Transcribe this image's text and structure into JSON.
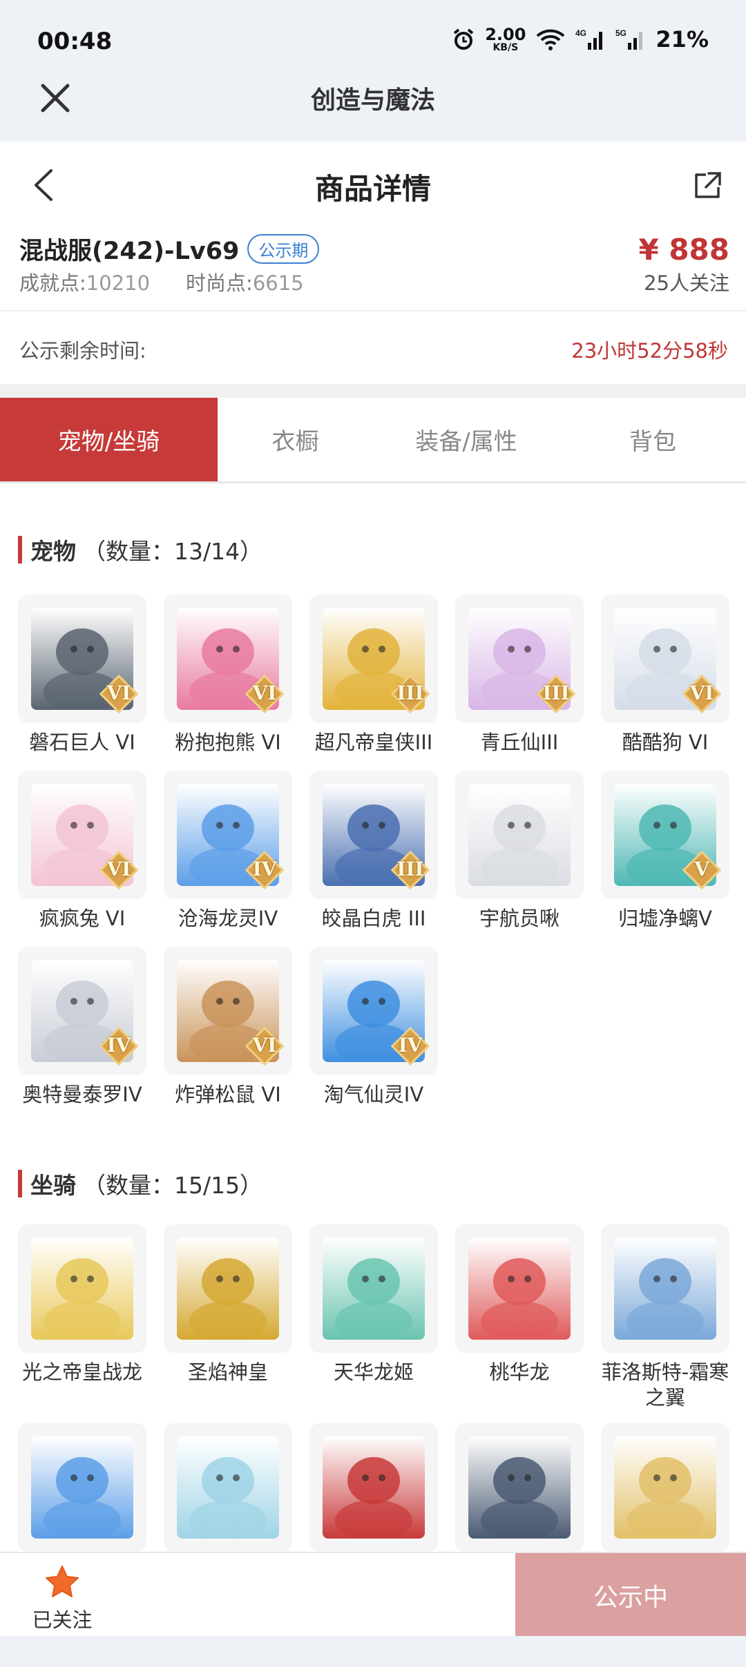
{
  "status_bar": {
    "time": "00:48",
    "net_speed": "2.00",
    "net_speed_unit": "KB/S",
    "battery": "21%"
  },
  "app_bar": {
    "title": "创造与魔法"
  },
  "nav": {
    "title": "商品详情"
  },
  "product": {
    "server": "混战服(242)-Lv69",
    "badge": "公示期",
    "achievement_label": "成就点:",
    "achievement_value": "10210",
    "fashion_label": "时尚点:",
    "fashion_value": "6615",
    "price": "¥ 888",
    "followers": "25人关注"
  },
  "countdown": {
    "label": "公示剩余时间:",
    "value": "23小时52分58秒"
  },
  "tabs": [
    {
      "label": "宠物/坐骑",
      "active": true
    },
    {
      "label": "衣橱",
      "active": false
    },
    {
      "label": "装备/属性",
      "active": false
    },
    {
      "label": "背包",
      "active": false
    }
  ],
  "pets": {
    "title": "宠物",
    "count": "（数量：13/14）",
    "items": [
      {
        "name": "磐石巨人 VI",
        "tier": "VI",
        "color": "#5a6470"
      },
      {
        "name": "粉抱抱熊 VI",
        "tier": "VI",
        "color": "#e87aa0"
      },
      {
        "name": "超凡帝皇侠III",
        "tier": "III",
        "color": "#e2b33c"
      },
      {
        "name": "青丘仙III",
        "tier": "III",
        "color": "#d8b6e6"
      },
      {
        "name": "酷酷狗 VI",
        "tier": "VI",
        "color": "#d6dde8"
      },
      {
        "name": "疯疯兔 VI",
        "tier": "VI",
        "color": "#f3c4d4"
      },
      {
        "name": "沧海龙灵IV",
        "tier": "IV",
        "color": "#5c9ee8"
      },
      {
        "name": "皎晶白虎 III",
        "tier": "III",
        "color": "#4a6fb0"
      },
      {
        "name": "宇航员啾",
        "tier": "",
        "color": "#dadde3"
      },
      {
        "name": "归墟净螭V",
        "tier": "V",
        "color": "#4fb8b4"
      },
      {
        "name": "奥特曼泰罗IV",
        "tier": "IV",
        "color": "#c8ccd6"
      },
      {
        "name": "炸弹松鼠 VI",
        "tier": "VI",
        "color": "#c9935a"
      },
      {
        "name": "淘气仙灵IV",
        "tier": "IV",
        "color": "#3f8fe0"
      }
    ]
  },
  "mounts": {
    "title": "坐骑",
    "count": "（数量：15/15）",
    "items": [
      {
        "name": "光之帝皇战龙",
        "color": "#e8c85a"
      },
      {
        "name": "圣焰神皇",
        "color": "#d4a832"
      },
      {
        "name": "天华龙姬",
        "color": "#6ac4b0"
      },
      {
        "name": "桃华龙",
        "color": "#e05a5a"
      },
      {
        "name": "菲洛斯特-霜寒之翼",
        "color": "#7aa8d8"
      },
      {
        "name": "",
        "color": "#5c9ee8"
      },
      {
        "name": "",
        "color": "#9fd4e6"
      },
      {
        "name": "",
        "color": "#c83a3a"
      },
      {
        "name": "",
        "color": "#4a5a72"
      },
      {
        "name": "",
        "color": "#e2c068"
      }
    ]
  },
  "bottom": {
    "follow_label": "已关注",
    "status_label": "公示中"
  }
}
